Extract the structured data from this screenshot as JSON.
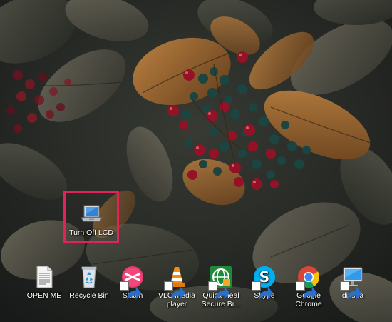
{
  "desktop": {
    "selected_icon": {
      "label": "Turn Off LCD",
      "icon": "laptop-icon",
      "highlight_color": "#e2235a"
    },
    "icons": [
      {
        "label": "OPEN ME",
        "icon": "document-icon"
      },
      {
        "label": "Recycle Bin",
        "icon": "recycle-bin-icon"
      },
      {
        "label": "Skitch",
        "icon": "skitch-icon",
        "shortcut": true
      },
      {
        "label": "VLC media player",
        "icon": "vlc-cone-icon",
        "shortcut": true
      },
      {
        "label": "Quick Heal Secure Br...",
        "icon": "quick-heal-browser-icon",
        "shortcut": true
      },
      {
        "label": "Skype",
        "icon": "skype-icon",
        "shortcut": true
      },
      {
        "label": "Google Chrome",
        "icon": "chrome-icon",
        "shortcut": true
      },
      {
        "label": "diksha",
        "icon": "computer-monitor-icon",
        "shortcut": true
      }
    ]
  }
}
